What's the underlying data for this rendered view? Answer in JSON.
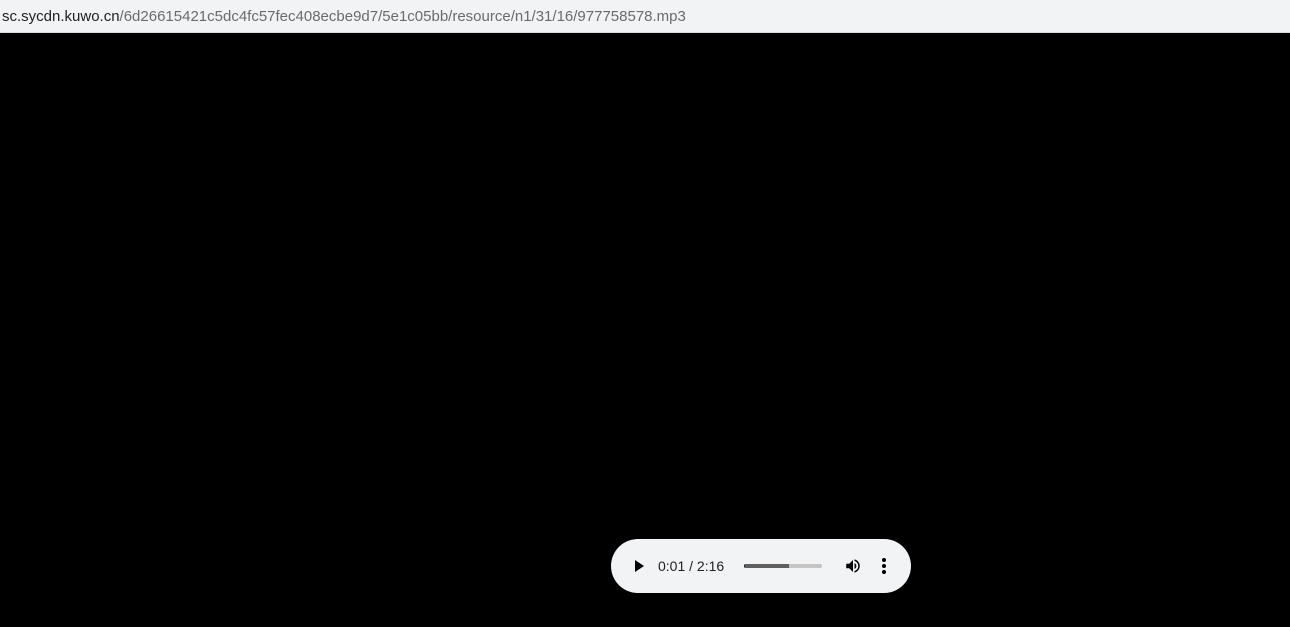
{
  "address_bar": {
    "host": "sc.sycdn.kuwo.cn",
    "path": "/6d26615421c5dc4fc57fec408ecbe9d7/5e1c05bb/resource/n1/31/16/977758578.mp3"
  },
  "audio_player": {
    "current_time": "0:01",
    "separator": " / ",
    "duration": "2:16",
    "played_fraction": 0.007,
    "buffered_fraction": 0.58,
    "icons": {
      "play": "play-icon",
      "volume": "volume-icon",
      "menu": "more-vertical-icon"
    }
  },
  "colors": {
    "page_background": "#000000",
    "bar_background": "#f1f3f4",
    "player_background": "#f1f3f4",
    "text_primary": "#202124",
    "text_secondary": "#6b6b6b"
  }
}
